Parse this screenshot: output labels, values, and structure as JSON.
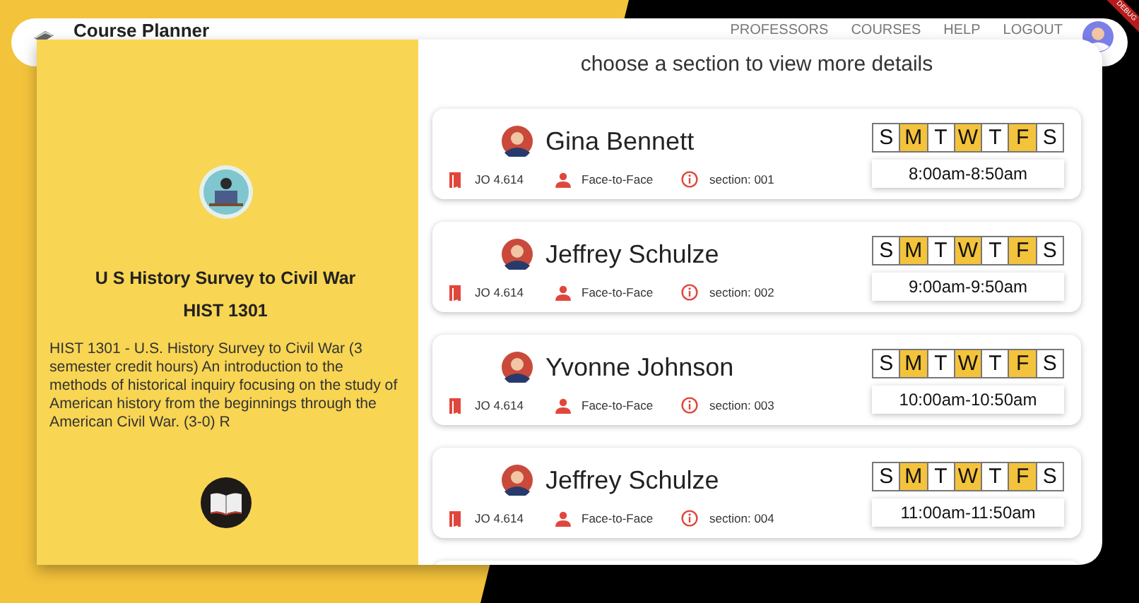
{
  "header": {
    "title": "Course Planner",
    "nav": [
      "PROFESSORS",
      "COURSES",
      "HELP",
      "LOGOUT"
    ]
  },
  "debug_banner": "DEBUG",
  "course": {
    "title": "U S History Survey to Civil War",
    "code": "HIST 1301",
    "description": "HIST 1301 - U.S. History Survey to Civil War (3 semester credit hours) An introduction to the methods of historical inquiry focusing on the study of American history from the beginnings through the American Civil War. (3-0) R"
  },
  "sections_heading": "choose a section to view more details",
  "sections": [
    {
      "professor": "Gina Bennett",
      "room": "JO 4.614",
      "mode": "Face-to-Face",
      "section": "section: 001",
      "time": "8:00am-8:50am",
      "days": [
        {
          "label": "S",
          "selected": false
        },
        {
          "label": "M",
          "selected": true
        },
        {
          "label": "T",
          "selected": false
        },
        {
          "label": "W",
          "selected": true
        },
        {
          "label": "T",
          "selected": false
        },
        {
          "label": "F",
          "selected": true
        },
        {
          "label": "S",
          "selected": false
        }
      ]
    },
    {
      "professor": "Jeffrey Schulze",
      "room": "JO 4.614",
      "mode": "Face-to-Face",
      "section": "section: 002",
      "time": "9:00am-9:50am",
      "days": [
        {
          "label": "S",
          "selected": false
        },
        {
          "label": "M",
          "selected": true
        },
        {
          "label": "T",
          "selected": false
        },
        {
          "label": "W",
          "selected": true
        },
        {
          "label": "T",
          "selected": false
        },
        {
          "label": "F",
          "selected": true
        },
        {
          "label": "S",
          "selected": false
        }
      ]
    },
    {
      "professor": "Yvonne Johnson",
      "room": "JO 4.614",
      "mode": "Face-to-Face",
      "section": "section: 003",
      "time": "10:00am-10:50am",
      "days": [
        {
          "label": "S",
          "selected": false
        },
        {
          "label": "M",
          "selected": true
        },
        {
          "label": "T",
          "selected": false
        },
        {
          "label": "W",
          "selected": true
        },
        {
          "label": "T",
          "selected": false
        },
        {
          "label": "F",
          "selected": true
        },
        {
          "label": "S",
          "selected": false
        }
      ]
    },
    {
      "professor": "Jeffrey Schulze",
      "room": "JO 4.614",
      "mode": "Face-to-Face",
      "section": "section: 004",
      "time": "11:00am-11:50am",
      "days": [
        {
          "label": "S",
          "selected": false
        },
        {
          "label": "M",
          "selected": true
        },
        {
          "label": "T",
          "selected": false
        },
        {
          "label": "W",
          "selected": true
        },
        {
          "label": "T",
          "selected": false
        },
        {
          "label": "F",
          "selected": true
        },
        {
          "label": "S",
          "selected": false
        }
      ]
    }
  ]
}
